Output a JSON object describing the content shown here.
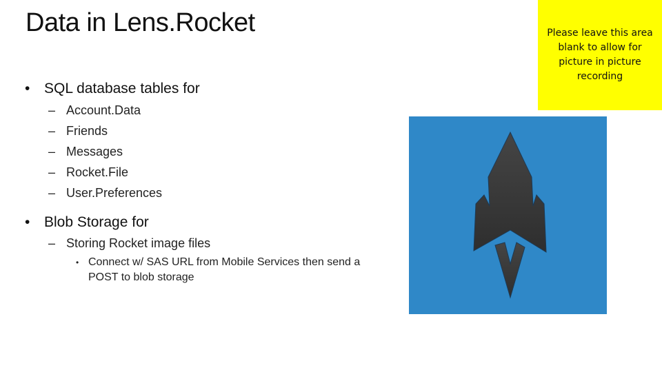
{
  "slide": {
    "title": "Data in Lens.Rocket",
    "bullets": [
      {
        "text": "SQL database tables for",
        "children": [
          {
            "text": "Account.Data"
          },
          {
            "text": "Friends"
          },
          {
            "text": "Messages"
          },
          {
            "text": "Rocket.File"
          },
          {
            "text": "User.Preferences"
          }
        ]
      },
      {
        "text": "Blob Storage for",
        "children": [
          {
            "text": "Storing Rocket image files",
            "children": [
              {
                "text": "Connect w/ SAS URL from Mobile Services then send a POST to blob storage"
              }
            ]
          }
        ]
      }
    ],
    "bullet_glyph": "•",
    "dash_glyph": "–",
    "small_bullet_glyph": "•"
  },
  "pip_placeholder": {
    "text": "Please leave this area blank to allow for picture in picture recording",
    "background": "#ffff00"
  },
  "logo": {
    "name": "rocket-logo",
    "background": "#2f88c8",
    "rocket_color": "#3a3a3a"
  }
}
